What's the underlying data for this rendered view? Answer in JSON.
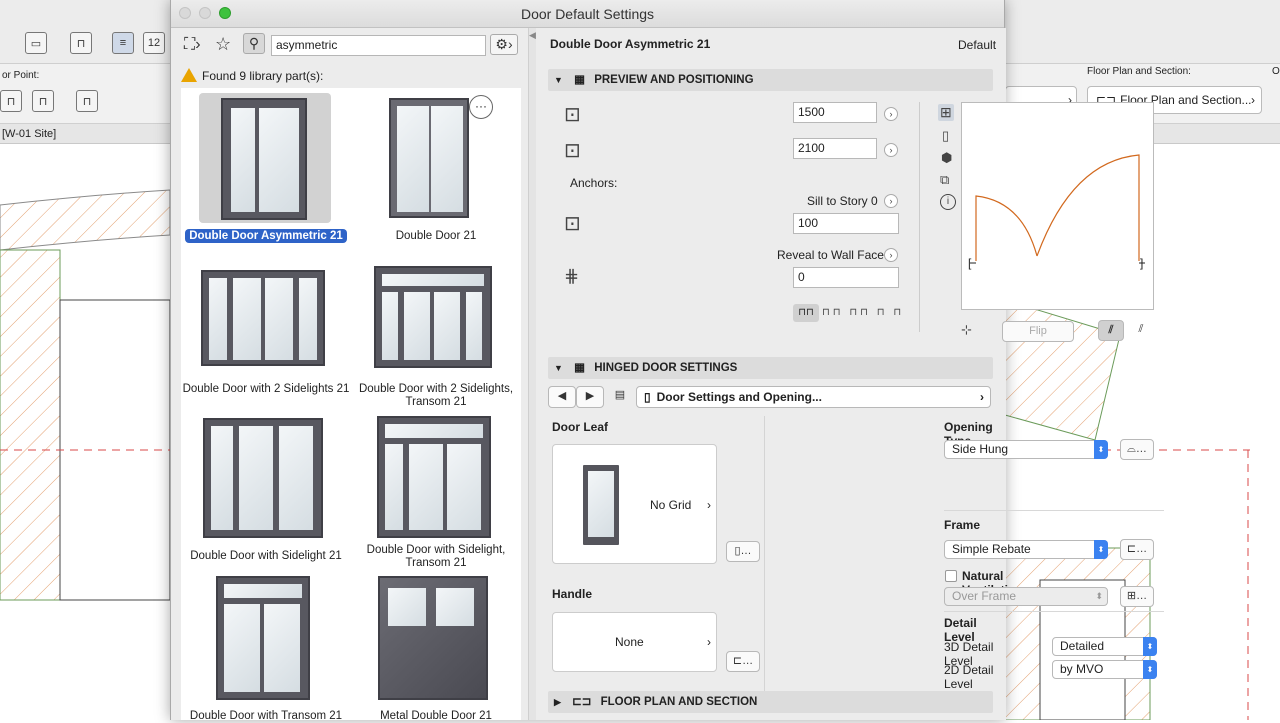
{
  "window": {
    "title": "Door Default Settings"
  },
  "background": {
    "left_label": "or Point:",
    "tab_label": "[W-01 Site]",
    "floorplan_header": "Floor Plan and Section:",
    "floorplan_dropdown": "Floor Plan and Section...",
    "right_edge_label": "O",
    "dim_label": "12"
  },
  "library": {
    "search_value": "asymmetric",
    "found_text": "Found 9 library part(s):",
    "items": [
      {
        "label": "Double Door Asymmetric 21",
        "selected": true
      },
      {
        "label": "Double Door 21",
        "selected": false
      },
      {
        "label": "Double Door with 2 Sidelights 21",
        "selected": false
      },
      {
        "label": "Double Door with 2 Sidelights, Transom 21",
        "selected": false
      },
      {
        "label": "Double Door with Sidelight 21",
        "selected": false
      },
      {
        "label": "Double Door with Sidelight, Transom 21",
        "selected": false
      },
      {
        "label": "Double Door with Transom 21",
        "selected": false
      },
      {
        "label": "Metal Double Door 21",
        "selected": false
      }
    ]
  },
  "settings": {
    "part_name": "Double Door Asymmetric 21",
    "default_label": "Default",
    "preview_section": "PREVIEW AND POSITIONING",
    "width_value": "1500",
    "height_value": "2100",
    "anchors_label": "Anchors:",
    "sill_label": "Sill to Story 0",
    "sill_value": "100",
    "reveal_label": "Reveal to Wall Face",
    "reveal_value": "0",
    "flip_label": "Flip",
    "hinged_section": "HINGED DOOR SETTINGS",
    "page_selector": "Door Settings and Opening...",
    "door_leaf_label": "Door Leaf",
    "door_leaf_value": "No Grid",
    "handle_label": "Handle",
    "handle_value": "None",
    "opening_type_label": "Opening Type",
    "opening_type_value": "Side Hung",
    "frame_label": "Frame",
    "frame_value": "Simple Rebate",
    "natural_vent_label": "Natural Ventilation",
    "natural_vent_checked": false,
    "over_frame_value": "Over Frame",
    "detail_level_label": "Detail Level",
    "detail_3d_label": "3D Detail Level",
    "detail_3d_value": "Detailed",
    "detail_2d_label": "2D Detail Level",
    "detail_2d_value": "by MVO",
    "floorplan_section": "FLOOR PLAN AND SECTION"
  },
  "colors": {
    "accent": "#3b82f0",
    "selection": "#2e63c8",
    "arc": "#d2691e",
    "hatch": "#e3a070"
  }
}
